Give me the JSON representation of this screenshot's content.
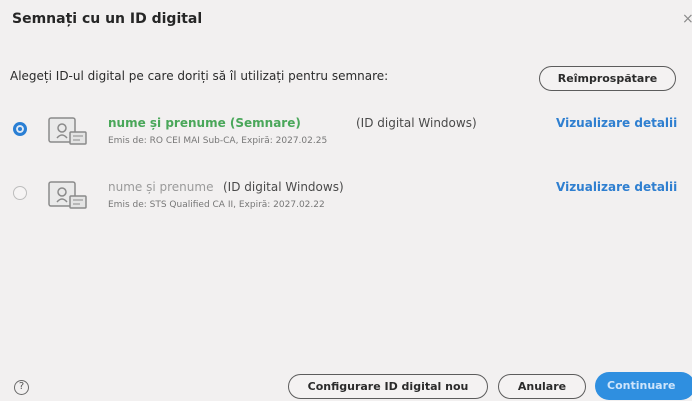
{
  "dialog": {
    "title": "Semnați cu un ID digital",
    "close_glyph": "×"
  },
  "prompt": "Alegeți ID-ul digital pe care doriți să îl utilizați pentru semnare:",
  "refresh_label": "Reîmprospătare",
  "ids": [
    {
      "selected": true,
      "name": "nume și prenume (Semnare)",
      "type": "(ID digital Windows)",
      "issuer": "Emis de: RO CEI MAI Sub-CA, Expiră: 2027.02.25",
      "details_label": "Vizualizare detalii"
    },
    {
      "selected": false,
      "name": "nume și prenume",
      "type": "(ID digital Windows)",
      "issuer": "Emis de: STS Qualified CA II, Expiră: 2027.02.22",
      "details_label": "Vizualizare detalii"
    }
  ],
  "footer": {
    "help_glyph": "?",
    "configure_label": "Configurare ID digital nou",
    "cancel_label": "Anulare",
    "continue_label": "Continuare"
  },
  "colors": {
    "accent": "#2a7fd4",
    "link": "#2f7fd0",
    "name_selected": "#4aa75a",
    "continue_bg": "#2f8fe0"
  },
  "icons": [
    "close-icon",
    "certificate-icon",
    "help-icon"
  ]
}
